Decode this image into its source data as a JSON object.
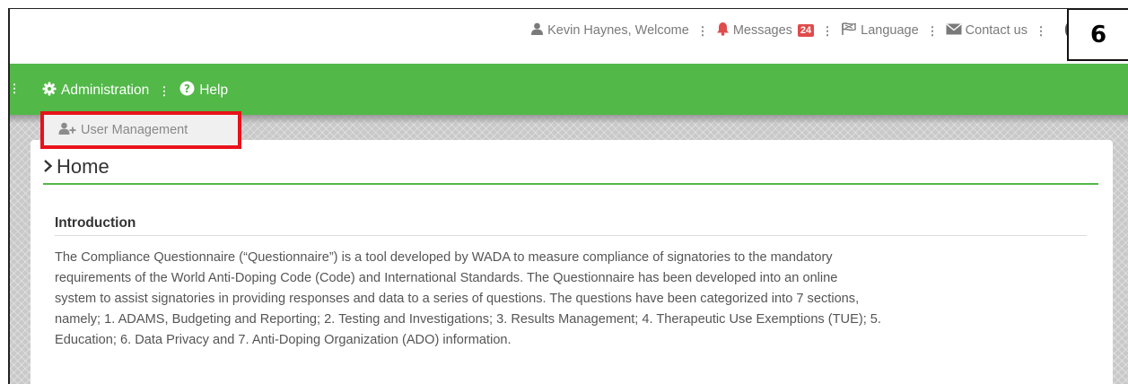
{
  "topbar": {
    "user_label": "Kevin Haynes, Welcome",
    "messages_label": "Messages",
    "messages_count": "24",
    "language_label": "Language",
    "contact_label": "Contact us"
  },
  "step_marker": "6",
  "nav": {
    "administration_label": "Administration",
    "help_label": "Help"
  },
  "dropdown": {
    "user_management_label": "User Management"
  },
  "page": {
    "title": "Home",
    "section_title": "Introduction",
    "intro_lines": [
      "The Compliance Questionnaire (“Questionnaire”) is a tool developed by WADA to measure compliance of signatories to the mandatory",
      "requirements of the World Anti-Doping Code (Code) and International Standards. The Questionnaire has been developed into an online",
      "system to assist signatories in providing responses and data to a series of questions. The questions have been categorized into 7 sections,",
      "namely; 1. ADAMS, Budgeting and Reporting; 2. Testing and Investigations; 3. Results Management; 4. Therapeutic Use Exemptions (TUE); 5.",
      "Education; 6. Data Privacy and 7. Anti-Doping Organization (ADO) information."
    ]
  },
  "colors": {
    "brand_green": "#52b848",
    "badge_red": "#e04b4b",
    "highlight_red": "#e8121b"
  }
}
